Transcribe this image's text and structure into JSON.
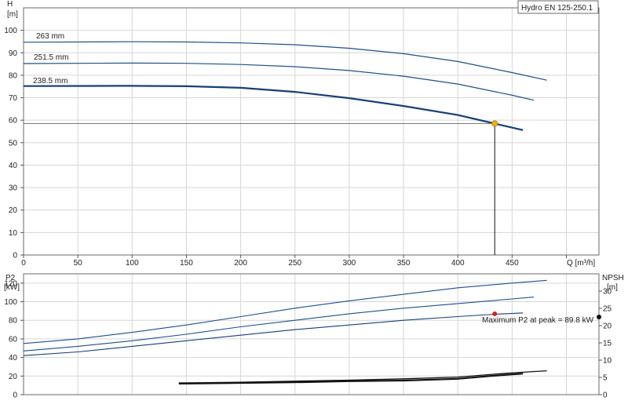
{
  "chart_data": [
    {
      "type": "line",
      "title": "Hydro EN 125-250.1",
      "xlabel": "Q [m³/h]",
      "ylabel_top": "H",
      "ylabel_unit": "[m]",
      "xlim": [
        0,
        530
      ],
      "ylim": [
        0,
        110
      ],
      "xticks": [
        0,
        50,
        100,
        150,
        200,
        250,
        300,
        350,
        400,
        450
      ],
      "yticks": [
        0,
        10,
        20,
        30,
        40,
        50,
        60,
        70,
        80,
        90,
        100
      ],
      "grid": true,
      "series": [
        {
          "name": "263 mm",
          "color": "#1f4e8c",
          "points": [
            [
              0,
              94.7
            ],
            [
              100,
              94.9
            ],
            [
              150,
              94.8
            ],
            [
              200,
              94.4
            ],
            [
              250,
              93.6
            ],
            [
              300,
              92
            ],
            [
              350,
              89.6
            ],
            [
              400,
              86.1
            ],
            [
              450,
              81.2
            ],
            [
              482,
              77.8
            ]
          ]
        },
        {
          "name": "251.5 mm",
          "color": "#1f4e8c",
          "points": [
            [
              0,
              85.2
            ],
            [
              100,
              85.4
            ],
            [
              150,
              85.3
            ],
            [
              200,
              84.8
            ],
            [
              250,
              83.8
            ],
            [
              300,
              82.1
            ],
            [
              350,
              79.6
            ],
            [
              400,
              76.1
            ],
            [
              450,
              71.1
            ],
            [
              470,
              68.9
            ]
          ]
        },
        {
          "name": "238.5 mm",
          "color": "#173f77",
          "emphasis": true,
          "points": [
            [
              0,
              75.2
            ],
            [
              95,
              75.3
            ],
            [
              150,
              75.1
            ],
            [
              200,
              74.4
            ],
            [
              250,
              72.6
            ],
            [
              300,
              69.8
            ],
            [
              350,
              66.3
            ],
            [
              400,
              62.3
            ],
            [
              434,
              58.5
            ],
            [
              460,
              55.6
            ]
          ]
        }
      ],
      "duty_point": {
        "x": 434,
        "y": 58.5,
        "color": "#f2b300"
      }
    },
    {
      "type": "line",
      "ylabel_left": "P2",
      "ylabel_left_unit": "[kW]",
      "ylabel_right": "NPSH",
      "ylabel_right_unit": "[m]",
      "ylim": [
        0,
        130
      ],
      "ylim_right": [
        0,
        35
      ],
      "yticks": [
        0,
        20,
        40,
        60,
        80,
        100,
        120
      ],
      "yticks_right": [
        0,
        5,
        10,
        15,
        20,
        25,
        30
      ],
      "grid": true,
      "annotation": "Maximum P2 at peak = 89.8 kW",
      "power_series": [
        {
          "name": "263 mm",
          "color": "#1f4e8c",
          "points": [
            [
              0,
              55
            ],
            [
              50,
              60
            ],
            [
              100,
              67
            ],
            [
              150,
              75
            ],
            [
              200,
              84
            ],
            [
              250,
              93
            ],
            [
              300,
              101
            ],
            [
              350,
              108
            ],
            [
              400,
              115
            ],
            [
              450,
              120
            ],
            [
              482,
              123
            ]
          ]
        },
        {
          "name": "251.5 mm",
          "color": "#1f4e8c",
          "points": [
            [
              0,
              47
            ],
            [
              50,
              52
            ],
            [
              100,
              58
            ],
            [
              150,
              65
            ],
            [
              200,
              73
            ],
            [
              250,
              80
            ],
            [
              300,
              87
            ],
            [
              350,
              93
            ],
            [
              400,
              98
            ],
            [
              450,
              103
            ],
            [
              470,
              105
            ]
          ]
        },
        {
          "name": "238.5 mm",
          "color": "#173f77",
          "points": [
            [
              0,
              42
            ],
            [
              50,
              46
            ],
            [
              100,
              52
            ],
            [
              150,
              58
            ],
            [
              200,
              64
            ],
            [
              250,
              70
            ],
            [
              300,
              75
            ],
            [
              350,
              80
            ],
            [
              400,
              84
            ],
            [
              434,
              86.5
            ],
            [
              460,
              88
            ]
          ]
        }
      ],
      "power_marker": {
        "x": 434,
        "y": 87,
        "color": "#d42020"
      },
      "npsh_marker": {
        "x": 530,
        "y": 22.5,
        "color": "#111111"
      },
      "npsh_series": [
        {
          "name": "NPSH upper",
          "color": "#111111",
          "points": [
            [
              143,
              3.4
            ],
            [
              200,
              3.6
            ],
            [
              250,
              3.9
            ],
            [
              300,
              4.2
            ],
            [
              350,
              4.6
            ],
            [
              400,
              5.1
            ],
            [
              440,
              6.1
            ],
            [
              460,
              6.5
            ],
            [
              482,
              6.9
            ]
          ]
        },
        {
          "name": "NPSH lower",
          "color": "#111111",
          "points": [
            [
              143,
              3.2
            ],
            [
              200,
              3.4
            ],
            [
              250,
              3.6
            ],
            [
              300,
              3.9
            ],
            [
              350,
              4.1
            ],
            [
              400,
              4.6
            ],
            [
              430,
              5.4
            ],
            [
              460,
              6.1
            ]
          ]
        }
      ]
    }
  ]
}
